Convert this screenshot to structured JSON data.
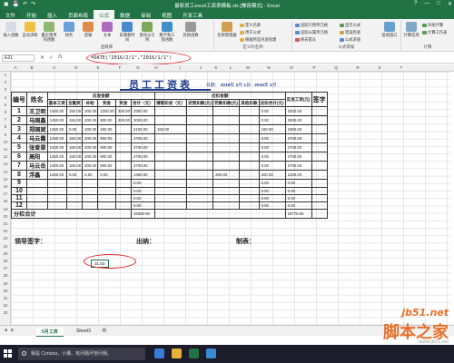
{
  "window": {
    "title": "最新员工excel工资表模板.xls [兼容模式] - Excel",
    "controls": [
      "?",
      "—",
      "□",
      "✕"
    ]
  },
  "tabs": [
    "文件",
    "开始",
    "插入",
    "页面布局",
    "公式",
    "数据",
    "审阅",
    "视图",
    "开发工具"
  ],
  "ribbon": {
    "buttons": [
      {
        "label": "插入函数",
        "color": "#d6dce8"
      },
      {
        "label": "自动求和",
        "color": "#f0c040"
      },
      {
        "label": "最近使用的函数",
        "color": "#8fb870"
      },
      {
        "label": "财务",
        "color": "#6a9fd8"
      },
      {
        "label": "逻辑",
        "color": "#e08a4a"
      },
      {
        "label": "文本",
        "color": "#b06ac0"
      },
      {
        "label": "日期和时间",
        "color": "#4a8ad0"
      },
      {
        "label": "查找与引用",
        "color": "#7aa85a"
      },
      {
        "label": "数学和三角函数",
        "color": "#3f8fc8"
      },
      {
        "label": "其他函数",
        "color": "#9a9a9a"
      },
      {
        "label": "名称管理器",
        "color": "#d0a050"
      },
      {
        "label": "监视窗口",
        "color": "#6aa0d0"
      },
      {
        "label": "计算选项",
        "color": "#80a8c8"
      }
    ],
    "small": [
      {
        "label": "定义名称",
        "color": "#e0b050"
      },
      {
        "label": "用于公式",
        "color": "#e0b050"
      },
      {
        "label": "根据所选内容创建",
        "color": "#e0b050"
      },
      {
        "label": "追踪引用单元格",
        "color": "#5a8ad0"
      },
      {
        "label": "追踪从属单元格",
        "color": "#5a8ad0"
      },
      {
        "label": "移去箭头",
        "color": "#d05a5a"
      },
      {
        "label": "显示公式",
        "color": "#5a9a5a"
      },
      {
        "label": "错误检查",
        "color": "#d0a050"
      },
      {
        "label": "公式求值",
        "color": "#5a8ad0"
      },
      {
        "label": "开始计算",
        "color": "#5a9a5a"
      },
      {
        "label": "计算工作表",
        "color": "#5a9a5a"
      }
    ],
    "groups": [
      "函数库",
      "定义的名称",
      "公式审核",
      "计算"
    ]
  },
  "formula_bar": {
    "cell": "E21",
    "fx_icons": [
      "✕",
      "✓",
      "fx"
    ],
    "formula": "=DATE(\"2016/2/1\",\"2016/1/1\")"
  },
  "columns": [
    "A",
    "B",
    "C",
    "D",
    "E",
    "F",
    "G",
    "H",
    "I",
    "J",
    "K",
    "L",
    "M",
    "N",
    "O",
    "P",
    "Q",
    "R",
    "S",
    "T"
  ],
  "rows": [
    "1",
    "2",
    "3",
    "4",
    "5",
    "6",
    "7",
    "8",
    "9",
    "10",
    "11",
    "12",
    "13",
    "14",
    "15",
    "16",
    "17",
    "18",
    "19",
    "20",
    "21",
    "22",
    "23",
    "24",
    "25",
    "26",
    "27",
    "28",
    "29",
    "30",
    "31",
    "32",
    "33"
  ],
  "sheet": {
    "title": "员工工资表",
    "date_label": "日期：",
    "date_year": "2016",
    "date_year_unit": "年",
    "date_month": "2",
    "date_month_unit": "月",
    "date_day": "1",
    "date_day_unit": "日",
    "date_sep": "-",
    "date_year2": "2016",
    "date_year2_unit": "年",
    "date_month2": "1",
    "date_month2_unit": "月"
  },
  "table": {
    "h_index": "编号",
    "h_name": "姓名",
    "h_should": "应发金额",
    "h_deduct": "应扣金额",
    "h_actual": "实发工资(元)",
    "h_sign": "签字",
    "cols": [
      "基本工资",
      "全勤奖",
      "补助",
      "奖金",
      "奖金",
      "合计（元）",
      "请假扣发（元）",
      "迟到扣款(元)",
      "罚款扣款(元)",
      "其他扣款",
      "应扣合计(元)"
    ],
    "rows": [
      {
        "no": "1",
        "name": "王卫明",
        "c": [
          "1450.00",
          "150.00",
          "200.00",
          "1200.00",
          "300.00",
          "3300.00",
          "",
          "",
          "",
          "",
          "0.00",
          "3300.00"
        ]
      },
      {
        "no": "2",
        "name": "马国鑫",
        "c": [
          "1450.00",
          "150.00",
          "200.00",
          "900.00",
          "300.00",
          "3000.00",
          "",
          "",
          "",
          "",
          "0.00",
          "3000.00"
        ]
      },
      {
        "no": "3",
        "name": "郑国斌",
        "c": [
          "1450.00",
          "0.00",
          "200.00",
          "450.00",
          "",
          "2100.00",
          "150.00",
          "",
          "",
          "",
          "150.00",
          "1950.00"
        ]
      },
      {
        "no": "4",
        "name": "马云霞",
        "c": [
          "1450.00",
          "150.00",
          "200.00",
          "900.00",
          "",
          "2700.00",
          "",
          "",
          "",
          "",
          "0.00",
          "2700.00"
        ]
      },
      {
        "no": "5",
        "name": "张爱翠",
        "c": [
          "1450.00",
          "150.00",
          "200.00",
          "900.00",
          "",
          "2700.00",
          "",
          "",
          "",
          "",
          "0.00",
          "2700.00"
        ]
      },
      {
        "no": "6",
        "name": "高阳",
        "c": [
          "1450.00",
          "150.00",
          "200.00",
          "900.00",
          "",
          "2700.00",
          "",
          "",
          "",
          "",
          "0.00",
          "2700.00"
        ]
      },
      {
        "no": "7",
        "name": "马云岳",
        "c": [
          "1450.00",
          "150.00",
          "200.00",
          "900.00",
          "",
          "2700.00",
          "",
          "",
          "",
          "",
          "0.00",
          "2700.00"
        ]
      },
      {
        "no": "8",
        "name": "浮鑫",
        "c": [
          "1450.00",
          "0.00",
          "0.00",
          "0.00",
          "",
          "1450.00",
          "",
          "",
          "200.00",
          "",
          "200.00",
          "1250.00"
        ]
      },
      {
        "no": "9",
        "name": "",
        "c": [
          "",
          "",
          "",
          "",
          "",
          "0.00",
          "",
          "",
          "",
          "",
          "0.00",
          "0.00"
        ]
      },
      {
        "no": "10",
        "name": "",
        "c": [
          "",
          "",
          "",
          "",
          "",
          "0.00",
          "",
          "",
          "",
          "",
          "0.00",
          "0.00"
        ]
      },
      {
        "no": "11",
        "name": "",
        "c": [
          "",
          "",
          "",
          "",
          "",
          "0.00",
          "",
          "",
          "",
          "",
          "0.00",
          "0.00"
        ]
      },
      {
        "no": "12",
        "name": "",
        "c": [
          "",
          "",
          "",
          "",
          "",
          "0.00",
          "",
          "",
          "",
          "",
          "0.00",
          "0.00"
        ]
      }
    ],
    "total_label": "分栏合计",
    "total_sum": "19300.00",
    "total_net": "18775.00"
  },
  "signatures": {
    "leader": "领导签字：",
    "cashier": "出纳：",
    "maker": "制表："
  },
  "selected_cell_value": "31.00",
  "sheet_tabs": [
    "5月工资",
    "Sheet3"
  ],
  "taskbar": {
    "search": "我是 Cortana，小娜。有问题尽管问我。"
  },
  "watermark": {
    "site": "jb51.net",
    "brand": "脚本之家",
    "url": "www.jb51.net"
  }
}
